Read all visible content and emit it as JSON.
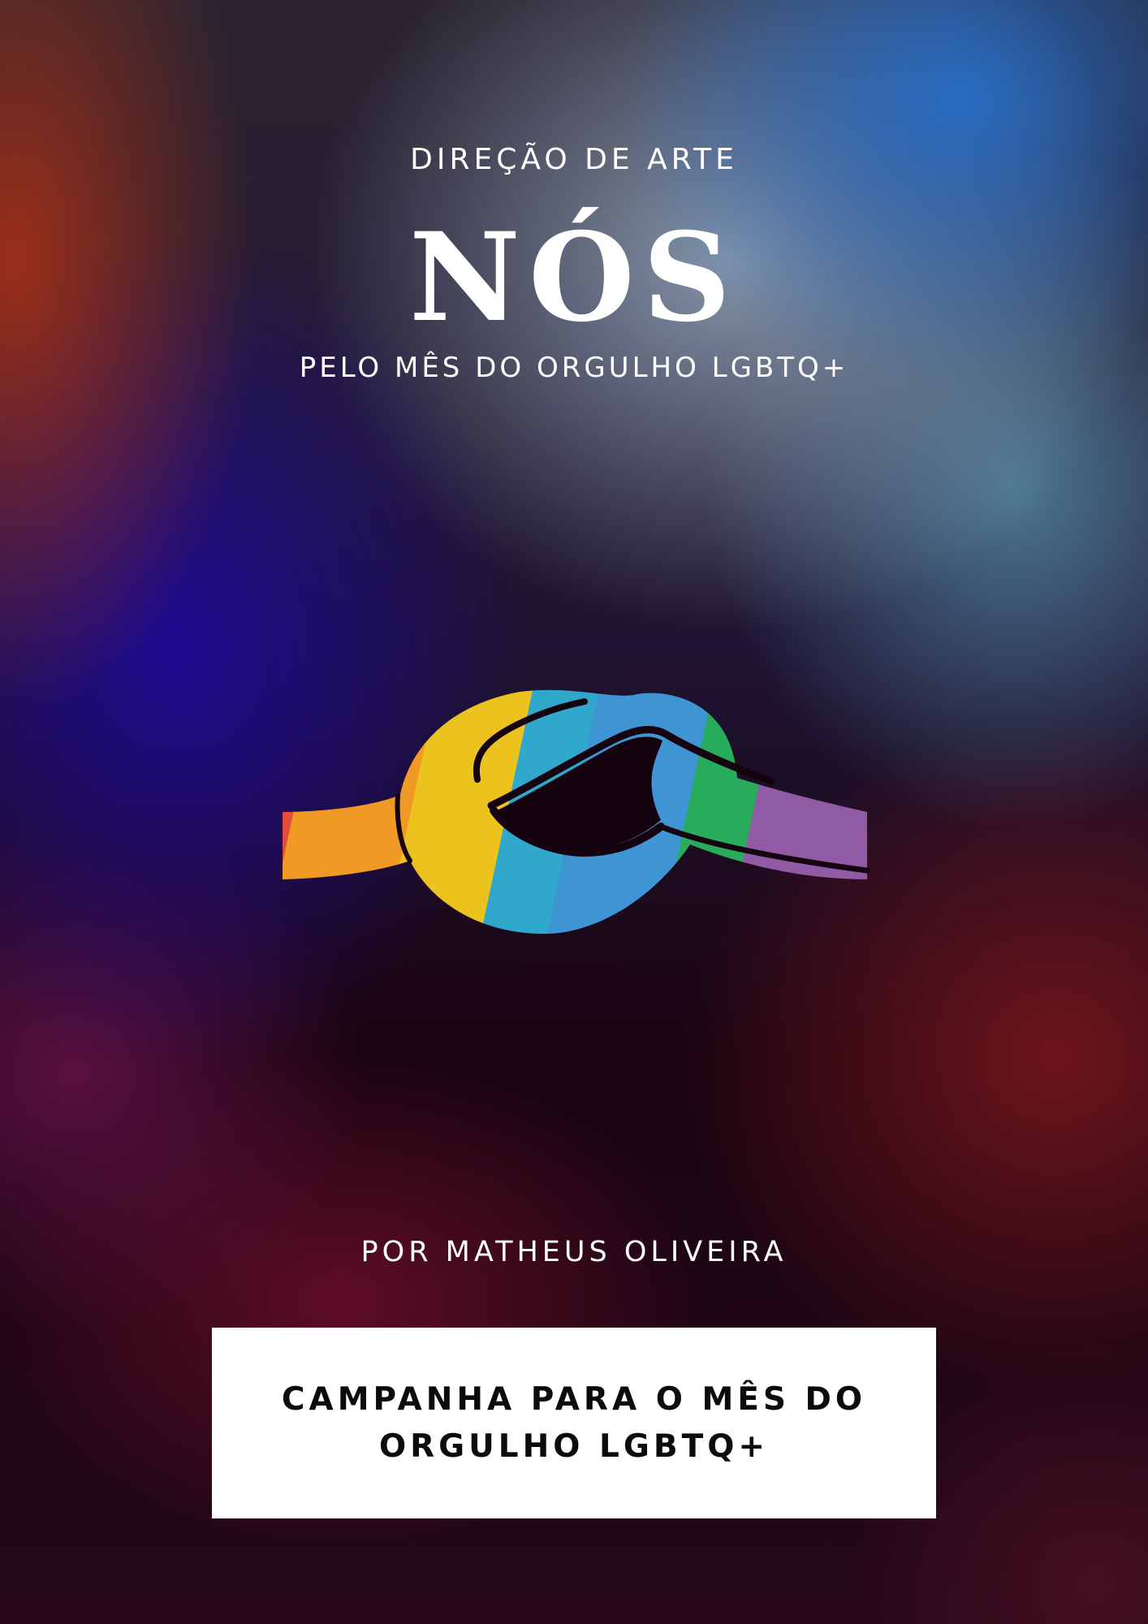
{
  "poster": {
    "kicker": "DIREÇÃO DE ARTE",
    "title": "NÓS",
    "subtitle": "PELO MÊS DO ORGULHO LGBTQ+",
    "author": "POR MATHEUS OLIVEIRA",
    "campaign": "CAMPANHA PARA O MÊS DO ORGULHO LGBTQ+"
  },
  "logo": {
    "icon": "rainbow-knot-icon",
    "colors": [
      "#e34e3c",
      "#f09a25",
      "#ecc31e",
      "#2fa8cc",
      "#3f95d3",
      "#28ac5c",
      "#905aa4"
    ]
  }
}
